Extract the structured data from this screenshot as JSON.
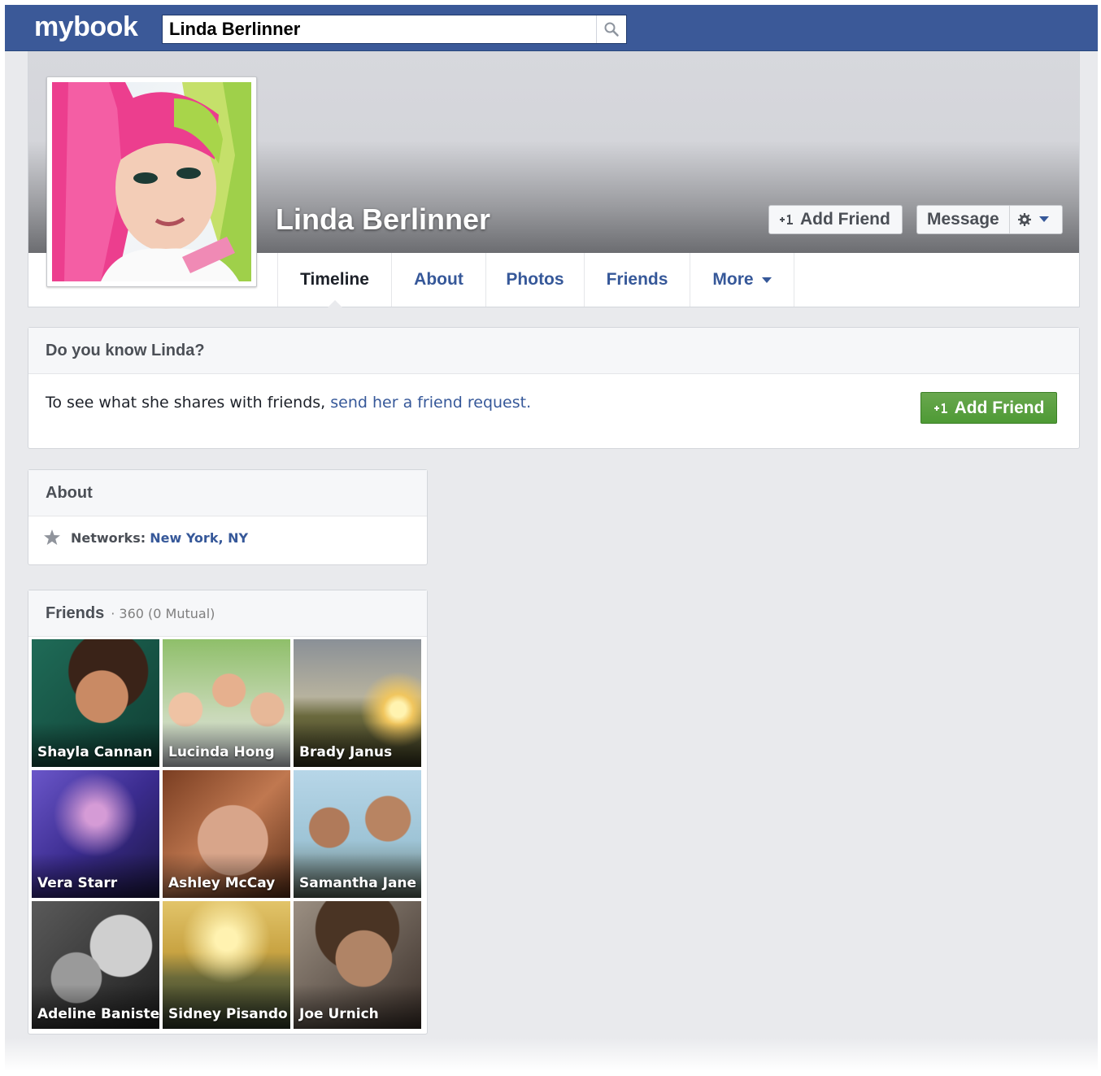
{
  "app": {
    "logo": "mybook",
    "brand_color": "#3b5998"
  },
  "search": {
    "value": "Linda Berlinner",
    "icon": "search-icon"
  },
  "profile": {
    "name": "Linda Berlinner",
    "add_friend_label": "Add Friend",
    "message_label": "Message",
    "settings_icon": "gear-icon"
  },
  "tabs": [
    {
      "label": "Timeline",
      "active": true
    },
    {
      "label": "About"
    },
    {
      "label": "Photos"
    },
    {
      "label": "Friends"
    },
    {
      "label": "More"
    }
  ],
  "know": {
    "title": "Do you know Linda?",
    "text": "To see what she shares with friends, ",
    "link": "send her a friend request.",
    "button": "Add Friend",
    "button_color": "#4e9a35"
  },
  "about": {
    "title": "About",
    "networks_label": "Networks:",
    "networks_value": "New York, NY",
    "icon": "star-icon"
  },
  "friends": {
    "title": "Friends",
    "count": "· 360 (0 Mutual)",
    "items": [
      {
        "name": "Shayla Cannan"
      },
      {
        "name": "Lucinda Hong"
      },
      {
        "name": "Brady Janus"
      },
      {
        "name": "Vera Starr"
      },
      {
        "name": "Ashley McCay"
      },
      {
        "name": "Samantha Jane"
      },
      {
        "name": "Adeline Banister"
      },
      {
        "name": "Sidney Pisando"
      },
      {
        "name": "Joe Urnich"
      }
    ]
  }
}
